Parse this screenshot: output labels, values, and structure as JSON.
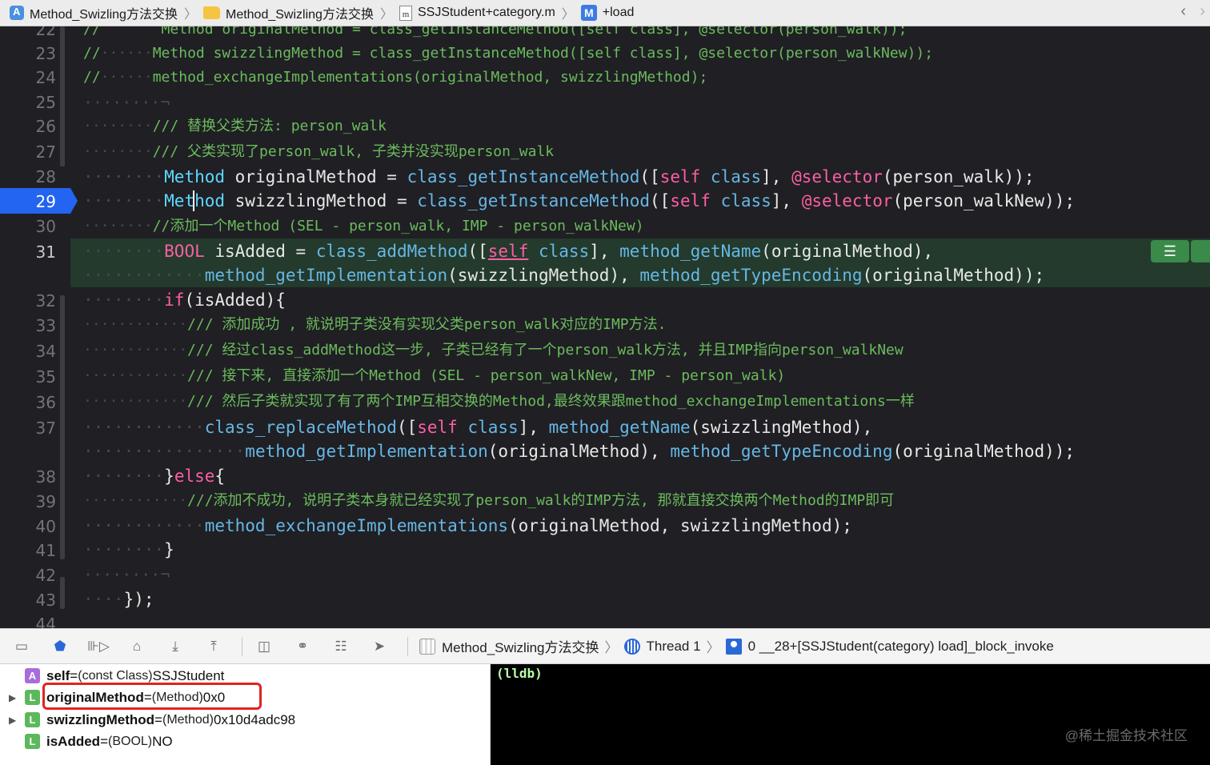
{
  "jumpbar": {
    "crumbs": [
      {
        "icon": "app-project-icon",
        "label": "Method_Swizling方法交换"
      },
      {
        "icon": "folder-icon",
        "label": "Method_Swizling方法交换"
      },
      {
        "icon": "m-file-icon",
        "label": "SSJStudent+category.m"
      },
      {
        "icon": "method-icon",
        "label": "+load"
      }
    ]
  },
  "editor": {
    "current_line": 29,
    "line_numbers": [
      "22",
      "23",
      "24",
      "25",
      "26",
      "27",
      "28",
      "29",
      "30",
      "31",
      "32",
      "33",
      "34",
      "35",
      "36",
      "37",
      "38",
      "39",
      "40",
      "41",
      "42",
      "43",
      "44"
    ],
    "lines": {
      "l22": "//       Method originalMethod = class_getInstanceMethod([self class], @selector(person_walk));",
      "l23_comment": "//",
      "l23_code": "Method swizzlingMethod = class_getInstanceMethod([self class], @selector(person_walkNew));",
      "l24_comment": "//",
      "l24_code": "method_exchangeImplementations(originalMethod, swizzlingMethod);",
      "l26": "/// 替换父类方法: person_walk",
      "l27": "/// 父类实现了person_walk, 子类并没实现person_walk",
      "l28_type": "Method",
      "l28_var": " originalMethod = ",
      "l28_fn": "class_getInstanceMethod",
      "l28_open": "([",
      "l28_self": "self",
      "l28_class": "class",
      "l28_mid": "], ",
      "l28_sel": "@selector",
      "l28_end": "(person_walk));",
      "l29_type": "Method",
      "l29_var": " swizzlingMethod = ",
      "l29_fn": "class_getInstanceMethod",
      "l29_end": "(person_walkNew));",
      "l30": "//添加一个Method (SEL - person_walk, IMP - person_walkNew)",
      "l31_type": "BOOL",
      "l31_var": " isAdded = ",
      "l31_fn": "class_addMethod",
      "l31_getname": "method_getName",
      "l31_end": "(originalMethod),",
      "l31b_fn1": "method_getImplementation",
      "l31b_mid": "(swizzlingMethod), ",
      "l31b_fn2": "method_getTypeEncoding",
      "l31b_end": "(originalMethod));",
      "l32_if": "if",
      "l32_end": "(isAdded){",
      "l33": "/// 添加成功 , 就说明子类没有实现父类person_walk对应的IMP方法.",
      "l34": "/// 经过class_addMethod这一步, 子类已经有了一个person_walk方法, 并且IMP指向person_walkNew",
      "l35": "/// 接下来, 直接添加一个Method (SEL - person_walkNew, IMP - person_walk)",
      "l36": "/// 然后子类就实现了有了两个IMP互相交换的Method,最终效果跟method_exchangeImplementations一样",
      "l37_fn": "class_replaceMethod",
      "l37_getname": "method_getName",
      "l37_end": "(swizzlingMethod),",
      "l37b_fn1": "method_getImplementation",
      "l37b_mid": "(originalMethod), ",
      "l37b_fn2": "method_getTypeEncoding",
      "l37b_end": "(originalMethod));",
      "l38_close": "}",
      "l38_else": "else",
      "l38_open": "{",
      "l39": "///添加不成功, 说明子类本身就已经实现了person_walk的IMP方法, 那就直接交换两个Method的IMP即可",
      "l40_fn": "method_exchangeImplementations",
      "l40_end": "(originalMethod, swizzlingMethod);",
      "l41": "}",
      "l43": "});"
    },
    "colors": {
      "keyword": "#fc5fa3",
      "type": "#5dd8ff",
      "function": "#67b7e4",
      "comment": "#6cbb5c",
      "current_line": "#2364f0"
    }
  },
  "debugbar": {
    "buttons": [
      "hide-debug-area-icon",
      "breakpoints-toggle-icon",
      "continue-icon",
      "step-over-icon",
      "step-into-icon",
      "step-out-icon",
      "view-hierarchy-icon",
      "memory-graph-icon",
      "environment-overrides-icon",
      "simulate-location-icon"
    ],
    "process": "Method_Swizling方法交换",
    "thread": "Thread 1",
    "frame": "0 __28+[SSJStudent(category) load]_block_invoke"
  },
  "variables": [
    {
      "badge": "A",
      "name": "self",
      "eq": " = ",
      "type": "(const Class)",
      "value": " SSJStudent",
      "expandable": false
    },
    {
      "badge": "L",
      "name": "originalMethod",
      "eq": " = ",
      "type": "(Method)",
      "value": " 0x0",
      "expandable": true
    },
    {
      "badge": "L",
      "name": "swizzlingMethod",
      "eq": " = ",
      "type": "(Method)",
      "value": " 0x10d4adc98",
      "expandable": true
    },
    {
      "badge": "L",
      "name": "isAdded",
      "eq": " = ",
      "type": "(BOOL)",
      "value": " NO",
      "expandable": false
    }
  ],
  "console": {
    "prompt": "(lldb)",
    "watermark": "@稀土掘金技术社区"
  }
}
